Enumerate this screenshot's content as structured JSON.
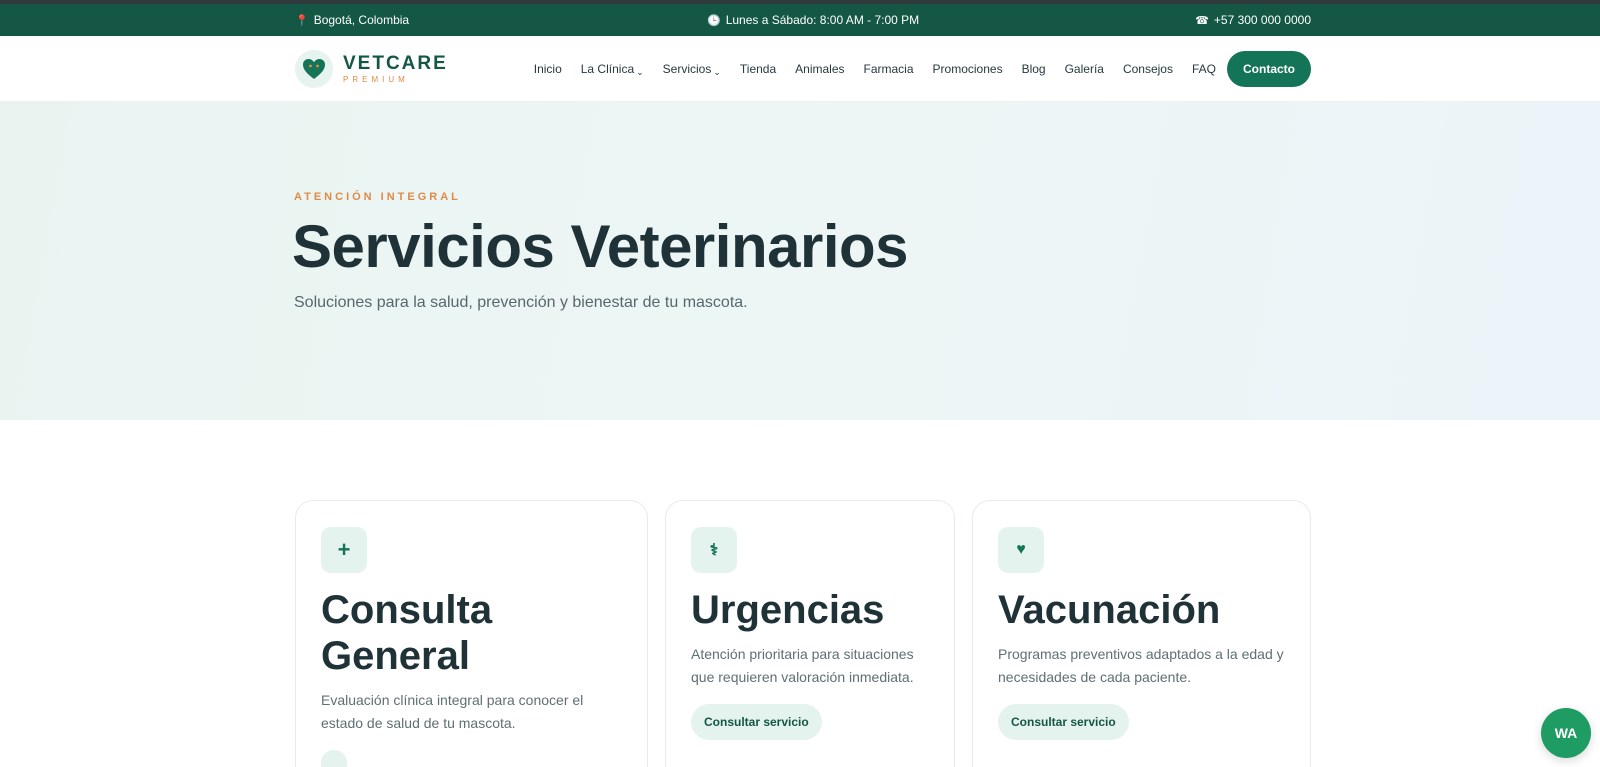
{
  "topbar": {
    "location": "Bogotá, Colombia",
    "location_icon": "map-pin-icon",
    "hours": "Lunes a Sábado: 8:00 AM - 7:00 PM",
    "hours_icon": "clock-icon",
    "phone": "+57 300 000 0000",
    "phone_icon": "phone-icon"
  },
  "brand": {
    "name": "VETCARE",
    "subtitle": "PREMIUM",
    "logo_icon": "heart-paw-icon"
  },
  "nav": {
    "items": [
      {
        "label": "Inicio",
        "has_dropdown": false
      },
      {
        "label": "La Clínica",
        "has_dropdown": true
      },
      {
        "label": "Servicios",
        "has_dropdown": true
      },
      {
        "label": "Tienda",
        "has_dropdown": false
      },
      {
        "label": "Animales",
        "has_dropdown": false
      },
      {
        "label": "Farmacia",
        "has_dropdown": false
      },
      {
        "label": "Promociones",
        "has_dropdown": false
      },
      {
        "label": "Blog",
        "has_dropdown": false
      },
      {
        "label": "Galería",
        "has_dropdown": false
      },
      {
        "label": "Consejos",
        "has_dropdown": false
      },
      {
        "label": "FAQ",
        "has_dropdown": false
      }
    ],
    "cta_label": "Contacto"
  },
  "hero": {
    "eyebrow": "ATENCIÓN INTEGRAL",
    "title": "Servicios Veterinarios",
    "subtitle": "Soluciones para la salud, prevención y bienestar de tu mascota."
  },
  "services": [
    {
      "icon": "plus-icon",
      "glyph": "+",
      "title_line1": "Consulta",
      "title_line2": "General",
      "description": "Evaluación clínica integral para conocer el estado de salud de tu mascota.",
      "button": ""
    },
    {
      "icon": "caduceus-icon",
      "glyph": "⚕",
      "title": "Urgencias",
      "description": "Atención prioritaria para situaciones que requieren valoración inmediata.",
      "button": "Consultar servicio"
    },
    {
      "icon": "heart-icon",
      "glyph": "♥",
      "title": "Vacunación",
      "description": "Programas preventivos adaptados a la edad y necesidades de cada paciente.",
      "button": "Consultar servicio"
    }
  ],
  "whatsapp": {
    "label": "WA",
    "icon": "whatsapp-icon"
  },
  "colors": {
    "brand_dark": "#145745",
    "brand": "#147458",
    "accent": "#e08a45",
    "whatsapp": "#1f9c63"
  }
}
